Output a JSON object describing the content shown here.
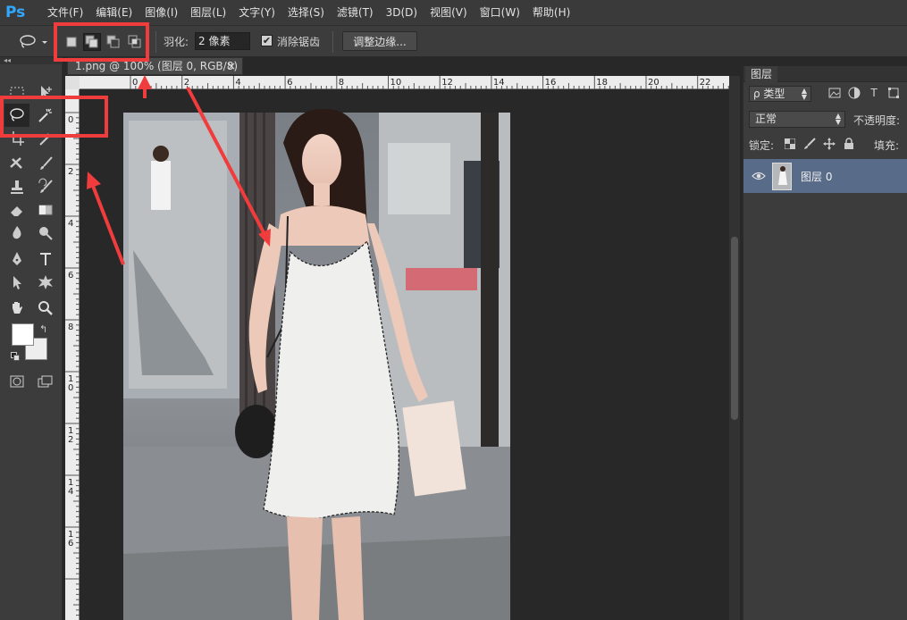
{
  "app": {
    "logo": "Ps",
    "menu": [
      "文件(F)",
      "编辑(E)",
      "图像(I)",
      "图层(L)",
      "文字(Y)",
      "选择(S)",
      "滤镜(T)",
      "3D(D)",
      "视图(V)",
      "窗口(W)",
      "帮助(H)"
    ]
  },
  "options": {
    "tool_icon": "lasso-icon",
    "modes": [
      "new-selection",
      "add-to-selection",
      "subtract-from-selection",
      "intersect-with-selection"
    ],
    "active_mode": "add-to-selection",
    "feather_label": "羽化:",
    "feather_value": "2 像素",
    "antialias_checked": true,
    "antialias_label": "消除锯齿",
    "refine_edge_label": "调整边缘..."
  },
  "document": {
    "tab_title": "1.png @ 100% (图层 0, RGB/8)",
    "close": "×",
    "ruler_h_labels": [
      "0",
      "2",
      "4",
      "6",
      "8",
      "10",
      "12",
      "14",
      "16",
      "18",
      "20",
      "22"
    ],
    "ruler_v_labels": [
      "0",
      "2",
      "4",
      "6",
      "8",
      "10",
      "12",
      "14",
      "16"
    ]
  },
  "layers_panel": {
    "tab": "图层",
    "filter_label": "ρ 类型",
    "filter_icons": [
      "image-filter-icon",
      "adjustment-filter-icon",
      "type-filter-icon",
      "shape-filter-icon"
    ],
    "type_glyph": "T",
    "blend_mode": "正常",
    "opacity_label": "不透明度:",
    "lock_label": "锁定:",
    "fill_label": "填充:",
    "layers": [
      {
        "name": "图层 0",
        "visible": true,
        "selected": true
      }
    ]
  },
  "colors": {
    "accent": "#31a8ff",
    "selected_layer": "#586b88",
    "annotation": "#f03c3c"
  }
}
